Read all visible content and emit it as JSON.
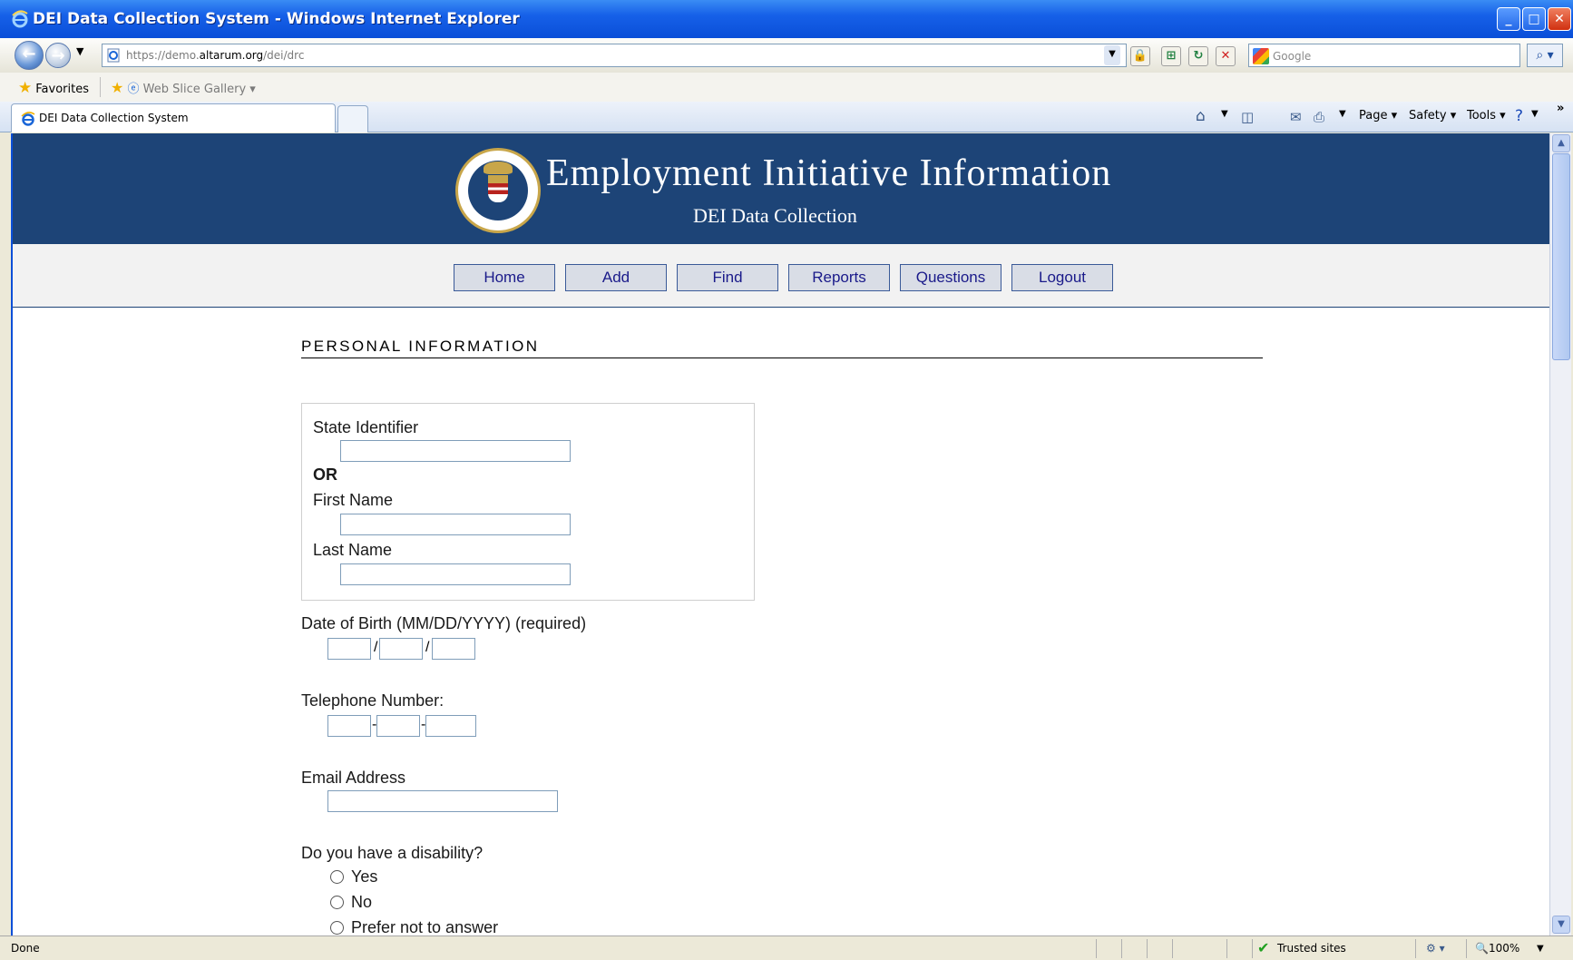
{
  "window": {
    "title": "DEI Data Collection System - Windows Internet Explorer",
    "controls": [
      "minimize",
      "maximize",
      "close"
    ]
  },
  "address_bar": {
    "url_prefix": "https://",
    "url_domain_pre": "demo.",
    "url_domain": "altarum.org",
    "url_path": "/dei/drc",
    "search_placeholder": "Google"
  },
  "favorites_bar": {
    "favorites_label": "Favorites",
    "web_slice_label": "Web Slice Gallery"
  },
  "tabs": [
    {
      "label": "DEI Data Collection System",
      "active": true
    }
  ],
  "command_bar": {
    "page_label": "Page",
    "safety_label": "Safety",
    "tools_label": "Tools"
  },
  "page": {
    "banner_title": "Employment Initiative Information",
    "banner_subtitle": "DEI Data Collection",
    "nav": [
      "Home",
      "Add",
      "Find",
      "Reports",
      "Questions",
      "Logout"
    ],
    "section_title": "PERSONAL INFORMATION",
    "state_identifier_label": "State Identifier",
    "or_label": "OR",
    "first_name_label": "First Name",
    "last_name_label": "Last Name",
    "dob_label": "Date of Birth (MM/DD/YYYY) (required)",
    "dob_separator": "/",
    "phone_label": "Telephone Number:",
    "phone_separator": "-",
    "email_label": "Email Address",
    "disability_question": "Do you have a disability?",
    "disability_options": [
      "Yes",
      "No",
      "Prefer not to answer"
    ]
  },
  "status_bar": {
    "status": "Done",
    "zone": "Trusted sites",
    "zoom": "100%"
  }
}
